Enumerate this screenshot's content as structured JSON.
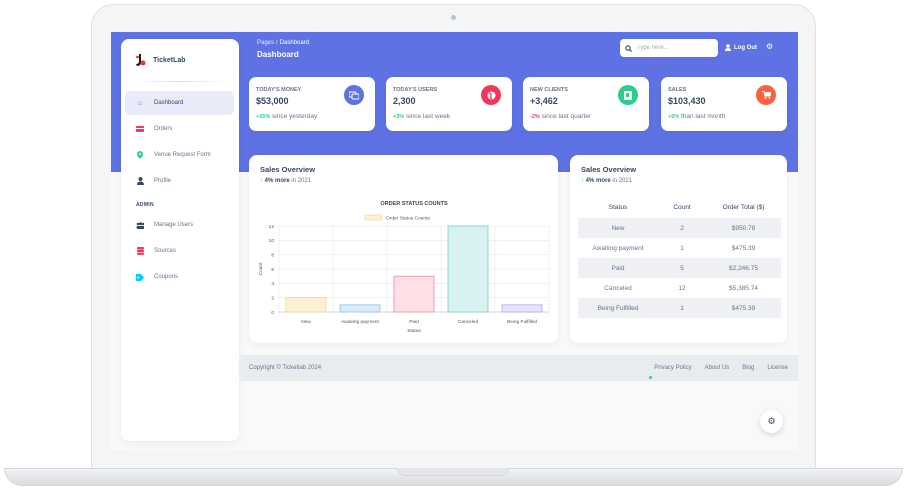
{
  "brand": {
    "name": "TicketLab"
  },
  "sidebar": {
    "items": [
      {
        "label": "Dashboard",
        "icon": "home-icon",
        "active": true
      },
      {
        "label": "Orders",
        "icon": "wallet-icon"
      },
      {
        "label": "Venue Request Form",
        "icon": "location-pin-icon"
      },
      {
        "label": "Profile",
        "icon": "user-icon"
      }
    ],
    "section_label": "ADMIN",
    "admin_items": [
      {
        "label": "Manage Users",
        "icon": "users-icon"
      },
      {
        "label": "Sources",
        "icon": "database-icon"
      },
      {
        "label": "Coupons",
        "icon": "tag-icon"
      }
    ]
  },
  "header": {
    "breadcrumb_root": "Pages",
    "breadcrumb_sep": "/",
    "breadcrumb_current": "Dashboard",
    "title": "Dashboard",
    "search_placeholder": "Type here...",
    "logout_label": "Log Out"
  },
  "stats": [
    {
      "label": "TODAY'S MONEY",
      "value": "$53,000",
      "change": "+55%",
      "note": " since yesterday",
      "trend": "up",
      "icon": "money-icon",
      "color": "#5e72e4"
    },
    {
      "label": "TODAY'S USERS",
      "value": "2,300",
      "change": "+3%",
      "note": " since last week",
      "trend": "up",
      "icon": "world-icon",
      "color": "#f5365c"
    },
    {
      "label": "NEW CLIENTS",
      "value": "+3,462",
      "change": "-2%",
      "note": " since last quarter",
      "trend": "down",
      "icon": "paper-icon",
      "color": "#2dce89"
    },
    {
      "label": "SALES",
      "value": "$103,430",
      "change": "+5%",
      "note": " than last month",
      "trend": "up",
      "icon": "cart-icon",
      "color": "#fb6340"
    }
  ],
  "chart_panel": {
    "title": "Sales Overview",
    "sub_bold": "4% more",
    "sub_rest": " in 2021"
  },
  "table_panel": {
    "title": "Sales Overview",
    "sub_bold": "4% more",
    "sub_rest": " in 2021",
    "columns": [
      "Status",
      "Count",
      "Order Total ($)"
    ],
    "rows": [
      [
        "New",
        "2",
        "$950.78"
      ],
      [
        "Awaiting payment",
        "1",
        "$475.39"
      ],
      [
        "Paid",
        "5",
        "$2,246.75"
      ],
      [
        "Canceled",
        "12",
        "$5,385.74"
      ],
      [
        "Being Fulfilled",
        "1",
        "$475.39"
      ]
    ]
  },
  "chart_data": {
    "type": "bar",
    "title": "ORDER STATUS COUNTS",
    "legend": "Order Status Counts",
    "xlabel": "Status",
    "ylabel": "Count",
    "categories": [
      "New",
      "Awaiting payment",
      "Paid",
      "Canceled",
      "Being Fulfilled"
    ],
    "values": [
      2,
      1,
      5,
      12,
      1
    ],
    "ylim": [
      0,
      12
    ],
    "yticks": [
      0,
      2,
      4,
      6,
      8,
      10,
      12
    ],
    "fills": [
      "#fdf1d4",
      "#dbeaf8",
      "#fde0e6",
      "#d8f1f1",
      "#e9e2fb"
    ],
    "strokes": [
      "#f7d28b",
      "#8fc1ec",
      "#f28ba0",
      "#7fcfcf",
      "#b9a2f3"
    ],
    "grid": true,
    "legend_position": "top"
  },
  "footer": {
    "copyright": "Copyright © Ticketlab 2024",
    "links": [
      "Privacy Policy",
      "About Us",
      "Blog",
      "License"
    ]
  }
}
